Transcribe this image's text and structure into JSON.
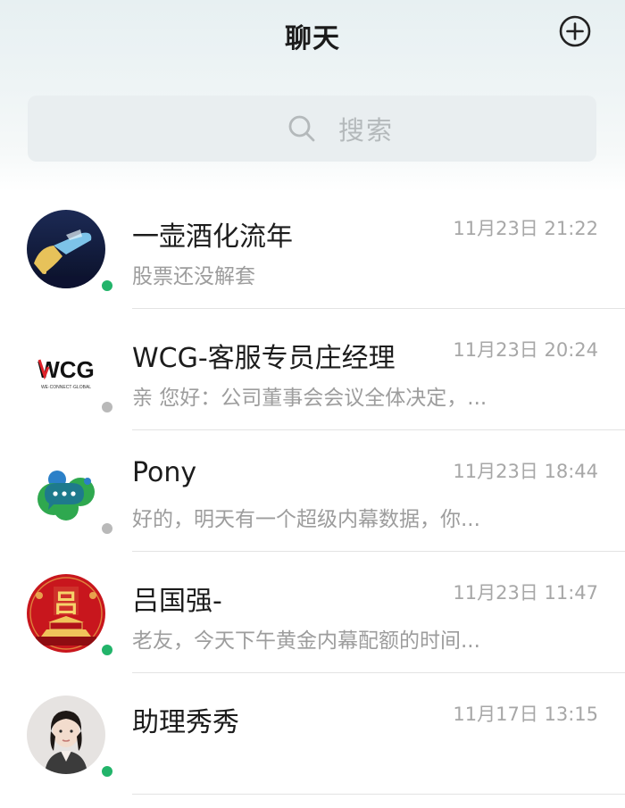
{
  "header": {
    "title": "聊天",
    "add_icon": "plus-circle-icon"
  },
  "search": {
    "placeholder": "搜索",
    "icon": "search-icon"
  },
  "colors": {
    "online": "#22b46a",
    "offline": "#b9b9b9",
    "divider": "#e3e3e3"
  },
  "chats": [
    {
      "name": "一壶酒化流年",
      "time": "11月23日 21:22",
      "preview": "股票还没解套",
      "status": "online"
    },
    {
      "name": "WCG-客服专员庄经理",
      "time": "11月23日 20:24",
      "preview": "亲 您好：公司董事会会议全体决定，...",
      "status": "offline",
      "avatar_text": "WCG",
      "avatar_subtext": "WE·CONNECT·GLOBAL"
    },
    {
      "name": "Pony",
      "time": "11月23日 18:44",
      "preview": "好的，明天有一个超级内幕数据，你...",
      "status": "offline"
    },
    {
      "name": "吕国强-",
      "time": "11月23日 11:47",
      "preview": "老友，今天下午黄金内幕配额的时间...",
      "status": "online",
      "avatar_text": "吕"
    },
    {
      "name": "助理秀秀",
      "time": "11月17日 13:15",
      "preview": "",
      "status": "online"
    }
  ]
}
